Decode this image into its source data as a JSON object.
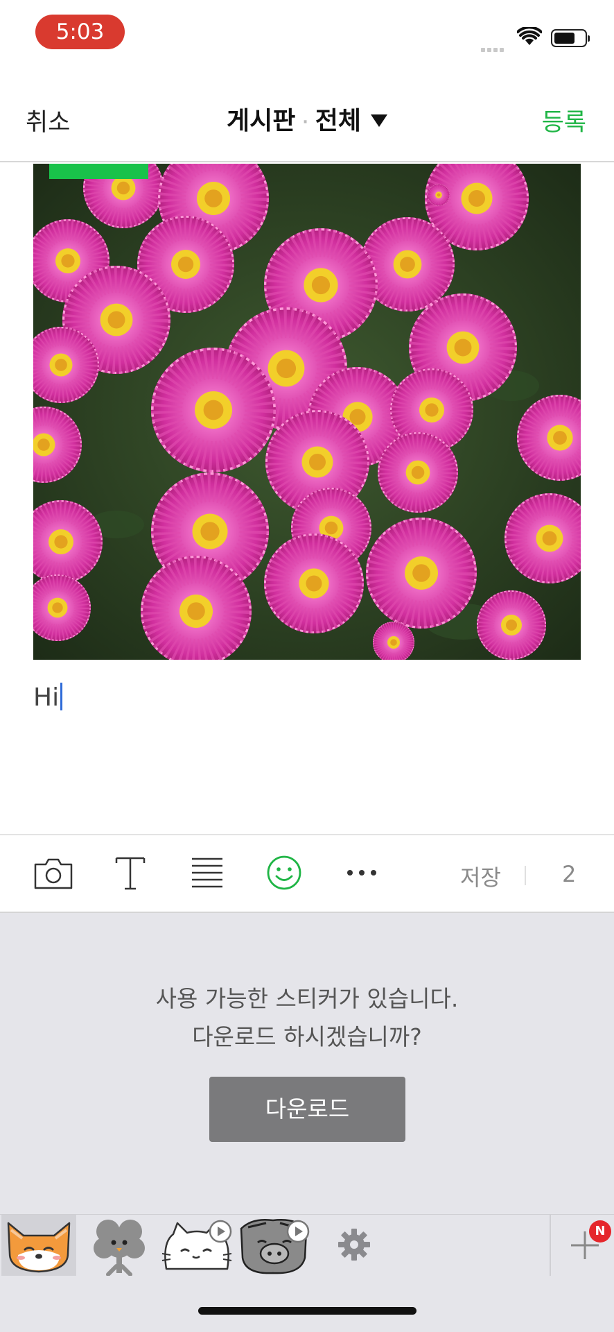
{
  "status_bar": {
    "time": "5:03"
  },
  "nav": {
    "cancel_label": "취소",
    "board_label": "게시판",
    "separator": "·",
    "filter_label": "전체",
    "register_label": "등록"
  },
  "post": {
    "text": "Hi"
  },
  "toolbar": {
    "camera_icon": "camera-icon",
    "text_icon": "text-format-icon",
    "align_icon": "align-lines-icon",
    "emoji_icon": "smiley-icon",
    "more_icon": "more-icon",
    "save_label": "저장",
    "count": "2"
  },
  "stickers": {
    "message_line1": "사용 가능한 스티커가 있습니다.",
    "message_line2": "다운로드 하시겠습니까?",
    "download_label": "다운로드"
  },
  "tray": {
    "items": [
      "fox-sticker",
      "clover-sticker",
      "cat-sticker",
      "pig-sticker",
      "settings-icon"
    ],
    "badge": "N"
  },
  "colors": {
    "accent": "#1fb545",
    "time_pill": "#d93a2f",
    "badge": "#e5262b"
  }
}
